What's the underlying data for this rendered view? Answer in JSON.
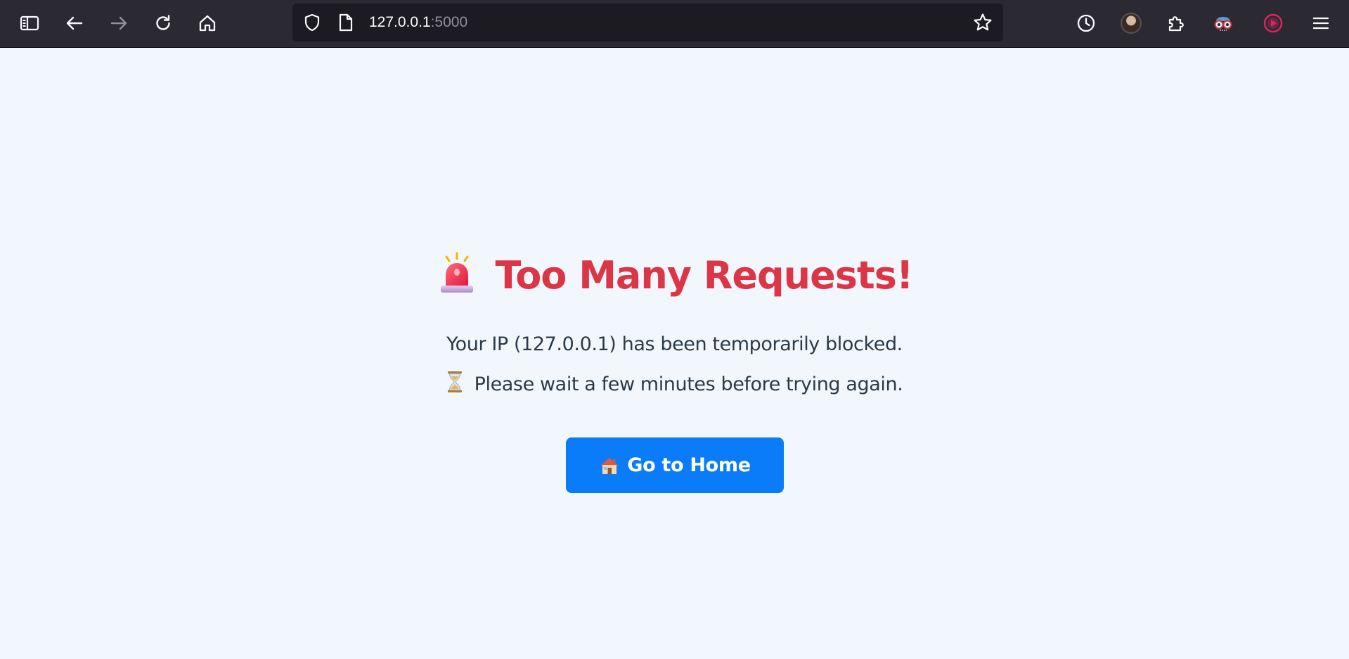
{
  "browser": {
    "toolbar_icons": {
      "sidebar": "sidebar-icon",
      "back": "back-arrow-icon",
      "forward": "forward-arrow-icon",
      "reload": "reload-icon",
      "home": "home-icon",
      "shield": "shield-icon",
      "page": "page-icon",
      "bookmark": "bookmark-star-icon",
      "history": "clock-icon",
      "account": "avatar",
      "extensions": "puzzle-icon",
      "ext_glasses": "glasses-extension-icon",
      "ext_record": "record-extension-icon",
      "menu": "hamburger-menu-icon"
    },
    "url": {
      "host": "127.0.0.1",
      "port": ":5000"
    },
    "colors": {
      "toolbar_bg": "#2b2a33",
      "urlbar_bg": "#1c1b22",
      "url_text": "#fbfbfe",
      "url_port": "#8f8f9d"
    }
  },
  "page": {
    "title_icon": "siren-emoji",
    "title": "Too Many Requests!",
    "message_line1": "Your IP (127.0.0.1) has been temporarily blocked.",
    "message_line2_icon": "hourglass-emoji",
    "message_line2": "Please wait a few minutes before trying again.",
    "home_button": {
      "icon": "house-emoji",
      "label": "Go to Home"
    },
    "colors": {
      "background": "#f2f7fd",
      "title": "#dc3545",
      "text": "#2b3a48",
      "button_bg": "#0a7cf9",
      "button_text": "#ffffff"
    }
  }
}
